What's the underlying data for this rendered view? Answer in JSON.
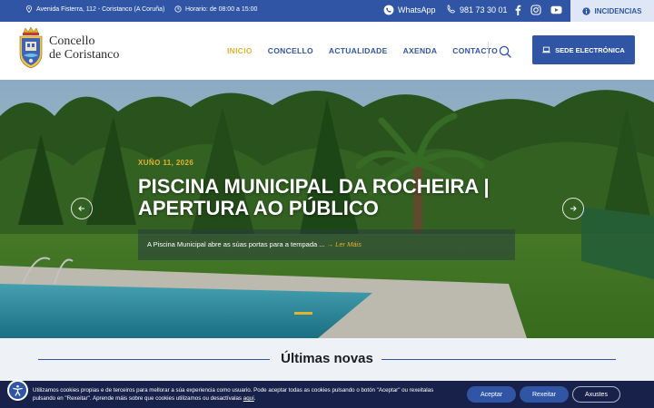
{
  "topbar": {
    "address": "Avenida Fisterra, 112 - Coristanco (A Coruña)",
    "hours": "Horario: de 08:00 a 15:00",
    "whatsapp": "WhatsApp",
    "phone": "981 73 30 01",
    "incidencias": "INCIDENCIAS"
  },
  "logo": {
    "line1": "Concello",
    "line2": "de Coristanco"
  },
  "nav": {
    "items": [
      "INICIO",
      "CONCELLO",
      "ACTUALIDADE",
      "AXENDA",
      "CONTACTO"
    ],
    "active": "INICIO"
  },
  "sede_button": "SEDE ELECTRÓNICA",
  "slide": {
    "date": "XUÑO 11, 2026",
    "title": "PISCINA MUNICIPAL DA ROCHEIRA | APERTURA AO PÚBLICO",
    "excerpt": "A Piscina Municipal abre as súas portas para a tempada ...",
    "read_more": "→ Ler Máis"
  },
  "news_heading": "Últimas novas",
  "cookie": {
    "text_before": "Utilizamos cookies propias e de terceiros para mellorar a súa experiencia como usuario. Pode aceptar todas as cookies pulsando o botón \"Aceptar\" ou rexeitalas pulsando en \"Rexeitar\". Aprende máis sobre que cookies utilizamos ou desactívalas ",
    "link": "aquí",
    "text_after": ".",
    "accept": "Aceptar",
    "reject": "Rexeitar",
    "settings": "Axustes"
  },
  "colors": {
    "brand_blue": "#2f55a4",
    "accent_gold": "#e1b32f",
    "cookie_bg": "#17214a"
  }
}
